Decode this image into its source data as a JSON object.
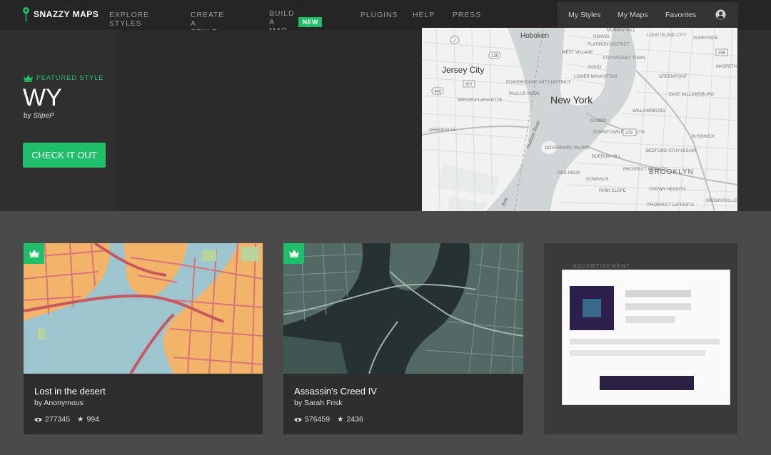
{
  "brand": {
    "name": "SNAZZY MAPS",
    "accent": "#1fbf6a"
  },
  "nav": {
    "items": [
      {
        "label": "EXPLORE STYLES"
      },
      {
        "label": "CREATE A STYLE"
      },
      {
        "label": "BUILD A MAP",
        "badge": "NEW"
      },
      {
        "label": "PLUGINS"
      },
      {
        "label": "HELP"
      },
      {
        "label": "PRESS"
      }
    ]
  },
  "user_menu": {
    "my_styles": "My Styles",
    "my_maps": "My Maps",
    "favorites": "Favorites",
    "icon": "user-circle-icon"
  },
  "hero": {
    "featured_label": "FEATURED STYLE",
    "title": "WY",
    "by_prefix": "by",
    "author": "StipeP",
    "cta": "CHECK IT OUT",
    "map_labels": {
      "hoboken": "Hoboken",
      "jersey_city": "Jersey City",
      "new_york": "New York",
      "brooklyn": "BROOKLYN",
      "hudson_river": "Hudson River",
      "greenville": "GREENVILLE",
      "governors_island": "GOVERNORS ISLAND",
      "red_hook": "RED HOOK",
      "park_slope": "PARK SLOPE",
      "downtown_brooklyn": "DOWNTOWN BROOKLYN",
      "dumbo": "DUMBO",
      "williamsburg": "WILLIAMSBURG",
      "greenpoint": "GREENPOINT",
      "long_island_city": "LONG ISLAND CITY",
      "bedford_stuyvesant": "BEDFORD-STUYVESANT",
      "crown_heights": "CROWN HEIGHTS",
      "prospect_heights": "PROSPECT HEIGHTS",
      "boerum_hill": "BOERUM HILL",
      "gowanus": "GOWANUS",
      "lower_manhattan": "LOWER MANHATTAN",
      "powerhouse": "POWERHOUSE ARTS DISTRICT",
      "paulus_hook": "PAULUS HOOK",
      "bergen": "BERGEN/ LAFAYETTE",
      "west_village": "WEST VILLAGE",
      "noho": "NOHO",
      "nomad": "NOMAD",
      "flatiron": "FLATIRON DISTRICT",
      "stuyvesant_town": "STUYVESANT TOWN",
      "sunnyside": "SUNNYSIDE",
      "maspeth": "MASPETH",
      "bushwick": "BUSHWICK",
      "brownsville": "BROWNSVILLE",
      "prospect_lefferts": "PROSPECT LEFFERTS",
      "murray_hill": "MURRAY HILL",
      "east_williamsburg": "EAST WILLIAMSBURG",
      "bay": "Bay",
      "r_139": "139",
      "r_440": "440",
      "r_607": "607",
      "r_7": "7",
      "r_278": "278",
      "r_495": "495"
    }
  },
  "cards": [
    {
      "title": "Lost in the desert",
      "by": "by Anonymous",
      "views": "277345",
      "favorites": "994"
    },
    {
      "title": "Assassin's Creed IV",
      "by": "by Sarah Frisk",
      "views": "576459",
      "favorites": "2436"
    }
  ],
  "ad": {
    "label": "ADVERTISEMENT"
  }
}
